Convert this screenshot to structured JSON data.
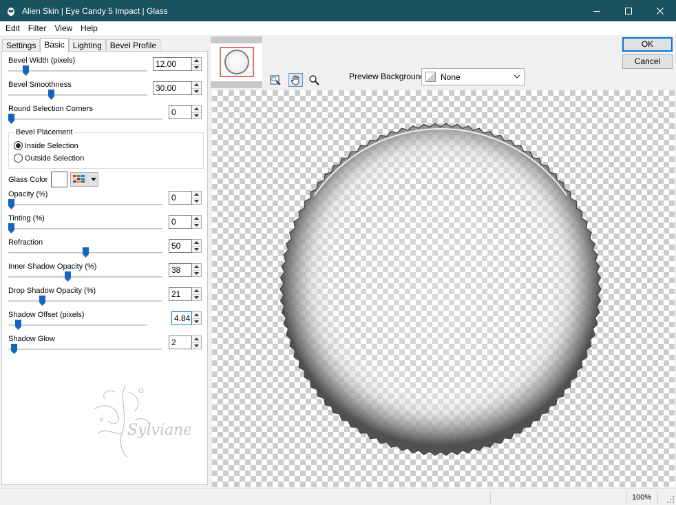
{
  "window": {
    "title": "Alien Skin | Eye Candy 5 Impact | Glass",
    "icons": [
      "app-icon",
      "minimize-icon",
      "maximize-icon",
      "close-icon"
    ]
  },
  "menu": [
    "Edit",
    "Filter",
    "View",
    "Help"
  ],
  "tabs": [
    "Settings",
    "Basic",
    "Lighting",
    "Bevel Profile"
  ],
  "active_tab": "Basic",
  "controls": {
    "bevel_width": {
      "label": "Bevel Width (pixels)",
      "value": "12.00",
      "level": 0.11
    },
    "bevel_smoothness": {
      "label": "Bevel Smoothness",
      "value": "30.00",
      "level": 0.3
    },
    "round_corners": {
      "label": "Round Selection Corners",
      "value": "0",
      "level": 0
    },
    "bevel_placement": {
      "title": "Bevel Placement",
      "options": [
        "Inside Selection",
        "Outside Selection"
      ],
      "selected": "Inside Selection"
    },
    "glass_color": {
      "label": "Glass Color",
      "color": "#ffffff"
    },
    "opacity": {
      "label": "Opacity (%)",
      "value": "0",
      "level": 0
    },
    "tinting": {
      "label": "Tinting (%)",
      "value": "0",
      "level": 0
    },
    "refraction": {
      "label": "Refraction",
      "value": "50",
      "level": 0.5
    },
    "inner_shadow_opacity": {
      "label": "Inner Shadow Opacity (%)",
      "value": "38",
      "level": 0.38
    },
    "drop_shadow_opacity": {
      "label": "Drop Shadow Opacity (%)",
      "value": "21",
      "level": 0.21
    },
    "shadow_offset": {
      "label": "Shadow Offset (pixels)",
      "value": "4.84",
      "level": 0.05
    },
    "shadow_glow": {
      "label": "Shadow Glow",
      "value": "2",
      "level": 0.02
    }
  },
  "watermark_text": "Sylviane",
  "buttons": {
    "ok": "OK",
    "cancel": "Cancel"
  },
  "preview_background": {
    "label": "Preview Background:",
    "value": "None"
  },
  "tools": [
    "navigate-preview-icon",
    "hand-tool-icon",
    "zoom-tool-icon"
  ],
  "status": {
    "zoom": "100%"
  },
  "colors": {
    "titlebar": "#1a525f",
    "slider_thumb": "#1565c0",
    "focus": "#0078d7",
    "thumb_frame": "#e53935"
  }
}
